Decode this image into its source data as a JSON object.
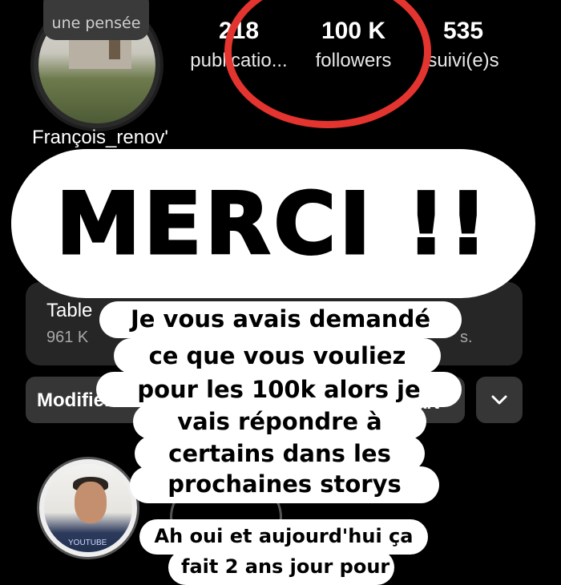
{
  "profile": {
    "note": "une pensée",
    "username": "François_renov'",
    "stats": [
      {
        "value": "218",
        "label": "publicatio..."
      },
      {
        "value": "100 K",
        "label": "followers"
      },
      {
        "value": "535",
        "label": "suivi(e)s"
      }
    ],
    "highlight_tag": "YOUTUBE"
  },
  "card": {
    "title": "Table",
    "subtitle": "961 K",
    "subtitle_right": "s."
  },
  "buttons": {
    "modify": "Modifier",
    "right_partial": "art",
    "expand_icon": "chevron-down-icon"
  },
  "story": {
    "headline": "MERCI !!",
    "caption_lines": [
      "Je vous avais demandé",
      "ce que vous vouliez",
      "pour les 100k alors je",
      "vais répondre à",
      "certains dans les",
      "prochaines storys"
    ],
    "second_caption_lines": [
      "Ah oui et aujourd'hui ça",
      "fait 2 ans jour pour"
    ]
  },
  "colors": {
    "background": "#000000",
    "highlight_circle": "#e3342f",
    "caption_bg": "#ffffff",
    "card_bg": "#262626"
  }
}
